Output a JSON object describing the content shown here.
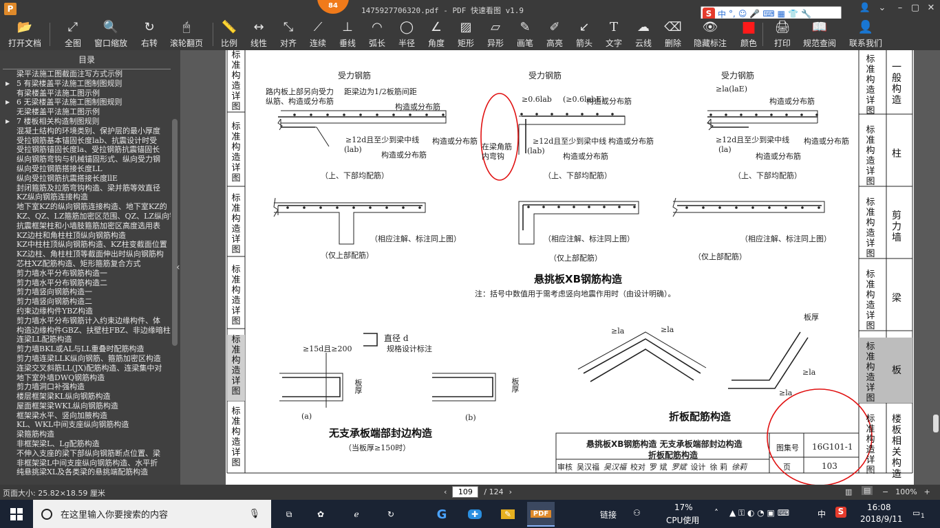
{
  "window": {
    "title": "1475927706320.pdf - PDF 快速看图 v1.9",
    "app_logo": "P",
    "badge": "84"
  },
  "ime": {
    "logo": "S",
    "items": [
      "中",
      "°,"
    ]
  },
  "toolbar": [
    {
      "id": "open",
      "label": "打开文档",
      "icon": "folder-icon"
    },
    {
      "id": "fit",
      "label": "全图",
      "icon": "expand-icon"
    },
    {
      "id": "window-zoom",
      "label": "窗口缩放",
      "icon": "magnifier-icon"
    },
    {
      "id": "rotate",
      "label": "右转",
      "icon": "rotate-icon"
    },
    {
      "id": "scroll-page",
      "label": "滚轮翻页",
      "icon": "mouse-icon"
    },
    {
      "id": "scale",
      "label": "比例",
      "icon": "ruler-icon"
    },
    {
      "id": "linear",
      "label": "线性",
      "icon": "dimension-icon"
    },
    {
      "id": "aligned",
      "label": "对齐",
      "icon": "aligned-icon"
    },
    {
      "id": "continuous",
      "label": "连续",
      "icon": "polyline-icon"
    },
    {
      "id": "perpendicular",
      "label": "垂线",
      "icon": "perpendicular-icon"
    },
    {
      "id": "arc-length",
      "label": "弧长",
      "icon": "arc-icon"
    },
    {
      "id": "radius",
      "label": "半径",
      "icon": "radius-icon"
    },
    {
      "id": "angle",
      "label": "角度",
      "icon": "angle-icon"
    },
    {
      "id": "rectangle",
      "label": "矩形",
      "icon": "rectangle-icon"
    },
    {
      "id": "irregular",
      "label": "异形",
      "icon": "irregular-icon"
    },
    {
      "id": "brush",
      "label": "画笔",
      "icon": "pen-icon"
    },
    {
      "id": "highlight",
      "label": "高亮",
      "icon": "highlighter-icon"
    },
    {
      "id": "arrow",
      "label": "箭头",
      "icon": "arrow-icon"
    },
    {
      "id": "text",
      "label": "文字",
      "icon": "text-icon"
    },
    {
      "id": "cloud",
      "label": "云线",
      "icon": "cloud-icon"
    },
    {
      "id": "delete",
      "label": "删除",
      "icon": "eraser-icon"
    },
    {
      "id": "hide-annot",
      "label": "隐藏标注",
      "icon": "eye-icon"
    },
    {
      "id": "color",
      "label": "颜色",
      "icon": "color-swatch-icon",
      "color": "#ff1a1a"
    },
    {
      "id": "print",
      "label": "打印",
      "icon": "printer-icon"
    },
    {
      "id": "spec",
      "label": "规范查阅",
      "icon": "book-icon"
    },
    {
      "id": "contact",
      "label": "联系我们",
      "icon": "person-icon"
    }
  ],
  "sidebar": {
    "header": "目录",
    "items": [
      {
        "text": "梁平法施工图截面注写方式示例",
        "arrow": false
      },
      {
        "text": "5 有梁楼盖平法施工图制图规则",
        "arrow": true
      },
      {
        "text": "有梁楼盖平法施工图示例",
        "arrow": false
      },
      {
        "text": "6 无梁楼盖平法施工图制图规则",
        "arrow": true
      },
      {
        "text": "无梁楼盖平法施工图示例",
        "arrow": false
      },
      {
        "text": "7 楼板相关构造制图规则",
        "arrow": true
      },
      {
        "text": "混凝土结构的环境类别、保护层的最小厚度",
        "arrow": false
      },
      {
        "text": "受拉钢筋基本锚固长度lab、抗震设计时受",
        "arrow": false
      },
      {
        "text": "受拉钢筋锚固长度la、受拉钢筋抗震锚固长",
        "arrow": false
      },
      {
        "text": "纵向钢筋弯钩与机械锚固形式、纵向受力钢",
        "arrow": false
      },
      {
        "text": "纵向受拉钢筋搭接长度LL",
        "arrow": false
      },
      {
        "text": "纵向受拉钢筋抗震搭接长度llE",
        "arrow": false
      },
      {
        "text": "封闭箍筋及拉筋弯钩构造、梁并筋等效直径",
        "arrow": false
      },
      {
        "text": "KZ纵向钢筋连接构造",
        "arrow": false
      },
      {
        "text": "地下室KZ的纵向钢筋连接构造、地下室KZ的",
        "arrow": false
      },
      {
        "text": "KZ、QZ、LZ箍筋加密区范围、QZ、LZ纵向钢",
        "arrow": false
      },
      {
        "text": "抗震框架柱和小墙肢箍筋加密区高度选用表",
        "arrow": false
      },
      {
        "text": "KZ边柱和角柱柱顶纵向钢筋构造",
        "arrow": false
      },
      {
        "text": "KZ中柱柱顶纵向钢筋构造、KZ柱变截面位置",
        "arrow": false
      },
      {
        "text": "KZ边柱、角柱柱顶等截面伸出时纵向钢筋构",
        "arrow": false
      },
      {
        "text": "芯柱XZ配筋构造、矩形箍筋复合方式",
        "arrow": false
      },
      {
        "text": "剪力墙水平分布钢筋构造一",
        "arrow": false
      },
      {
        "text": "剪力墙水平分布钢筋构造二",
        "arrow": false
      },
      {
        "text": "剪力墙竖向钢筋构造一",
        "arrow": false
      },
      {
        "text": "剪力墙竖向钢筋构造二",
        "arrow": false
      },
      {
        "text": "约束边缘构件YBZ构造",
        "arrow": false
      },
      {
        "text": "剪力墙水平分布钢筋计入约束边缘构件、体",
        "arrow": false
      },
      {
        "text": "构造边缘构件GBZ、扶壁柱FBZ、非边缘暗柱",
        "arrow": false
      },
      {
        "text": "连梁LL配筋构造",
        "arrow": false
      },
      {
        "text": "剪力墙BKL或AL与LL重叠时配筋构造",
        "arrow": false
      },
      {
        "text": "剪力墙连梁LLK纵向钢筋、箍筋加密区构造",
        "arrow": false
      },
      {
        "text": "连梁交叉斜筋LL(JX)配筋构造、连梁集中对",
        "arrow": false
      },
      {
        "text": "地下室外墙DWQ钢筋构造",
        "arrow": false
      },
      {
        "text": "剪力墙洞口补强构造",
        "arrow": false
      },
      {
        "text": "楼层框架梁KL纵向钢筋构造",
        "arrow": false
      },
      {
        "text": "屋面框架梁WKL纵向钢筋构造",
        "arrow": false
      },
      {
        "text": "框架梁水平、竖向加腋构造",
        "arrow": false
      },
      {
        "text": "KL、WKL中间支座纵向钢筋构造",
        "arrow": false
      },
      {
        "text": "梁箍筋构造",
        "arrow": false
      },
      {
        "text": "非框架梁L、Lg配筋构造",
        "arrow": false
      },
      {
        "text": "不伸入支座的梁下部纵向钢筋断点位置、梁",
        "arrow": false
      },
      {
        "text": "非框架梁L中间支座纵向钢筋构造、水平折",
        "arrow": false
      },
      {
        "text": "纯悬挑梁XL及各类梁的悬挑端配筋构造",
        "arrow": false
      }
    ]
  },
  "drawing": {
    "left_tabs": [
      {
        "text": "标准构造详图",
        "prefix": "一般"
      },
      {
        "text": "标准构造详图"
      },
      {
        "text": "标准构造详图"
      },
      {
        "text": "标准构造详图"
      },
      {
        "text": "标准构造详图",
        "active": true
      },
      {
        "text": "标准构造详图"
      }
    ],
    "right_tabs": [
      {
        "title": "标准构造详图",
        "label": "一般构造"
      },
      {
        "title": "标准构造详图",
        "label": "柱"
      },
      {
        "title": "标准构造详图",
        "label": "剪力墙"
      },
      {
        "title": "标准构造详图",
        "label": "梁"
      },
      {
        "title": "标准构造详图",
        "label": "板",
        "active": true
      },
      {
        "title": "标准构造详图",
        "label": "楼板相关构造"
      }
    ],
    "labels": {
      "force_rebar": "受力钢筋",
      "note_left_1": "路内板上部另向受力",
      "note_left_2": "纵筋、构造或分布筋",
      "note_spacing": "距梁边为1/2板筋间距",
      "dist_rebar": "构造或分布筋",
      "anchor": "≥12d且至少到梁中线",
      "lab": "(lab)",
      "la": "(la)",
      "both_rebar": "（上、下部均配筋）",
      "top_only": "（仅上部配筋）",
      "same_note": "（相应注解、标注同上图）",
      "hook_note_1": "在梁角筋",
      "hook_note_2": "内弯钩",
      "l06_1": "≥0.6lab",
      "l06_2": "(≥0.6labE)",
      "la_top": "≥la(laE)",
      "title_xb": "悬挑板XB钢筋构造",
      "note_xb": "注：括号中数值用于需考虑竖向地震作用时（由设计明确）。",
      "dia": "直径 d",
      "dia_note": "规格设计标注",
      "anchor15": "≥15d且≥200",
      "thickness": "板厚",
      "fig_a": "(a)",
      "fig_b": "(b)",
      "title_edge": "无支承板端部封边构造",
      "edge_sub": "（当板厚≥150时）",
      "title_fold": "折板配筋构造",
      "la_sym": "≥la"
    },
    "titleblock": {
      "name_line1": "悬挑板XB钢筋构造  无支承板端部封边构造",
      "name_line2": "折板配筋构造",
      "atlas_label": "图集号",
      "atlas_no": "16G101-1",
      "page_label": "页",
      "page_no": "103",
      "review_row": [
        "审核",
        "吴汉福",
        "吴汉福",
        "校对",
        "罗  斌",
        "罗斌",
        "设计",
        "徐  莉",
        "徐莉"
      ]
    },
    "annotation_color": "#e01010"
  },
  "status": {
    "page_size": "页面大小: 25.82×18.59 厘米",
    "current_page": "109",
    "total_pages": "/ 124",
    "zoom": "100%"
  },
  "taskbar": {
    "search_placeholder": "在这里输入你要搜索的内容",
    "tray_link": "链接",
    "cpu_percent": "17%",
    "cpu_label": "CPU使用",
    "ime": "中",
    "time": "16:08",
    "date": "2018/9/11",
    "notifications": "1"
  }
}
